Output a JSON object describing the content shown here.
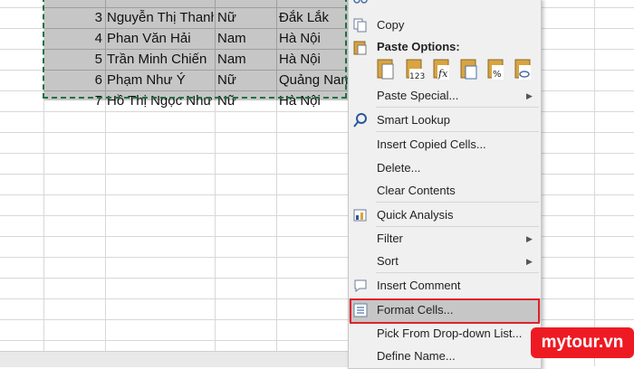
{
  "sheet": {
    "rows": [
      {
        "no": "3",
        "name": "Nguyễn Thị Thanh",
        "gender": "Nữ",
        "place": "Đắk Lắk"
      },
      {
        "no": "4",
        "name": "Phan Văn Hải",
        "gender": "Nam",
        "place": "Hà Nội"
      },
      {
        "no": "5",
        "name": "Trần Minh Chiến",
        "gender": "Nam",
        "place": "Hà Nội"
      },
      {
        "no": "6",
        "name": "Phạm Như Ý",
        "gender": "Nữ",
        "place": "Quảng Nam"
      },
      {
        "no": "7",
        "name": "Hồ Thị Ngọc Như",
        "gender": "Nữ",
        "place": "Hà Nội"
      }
    ]
  },
  "menu": {
    "copy": "Copy",
    "paste_options": "Paste Options:",
    "paste_special": "Paste Special...",
    "smart_lookup": "Smart Lookup",
    "insert_copied_cells": "Insert Copied Cells...",
    "delete": "Delete...",
    "clear_contents": "Clear Contents",
    "quick_analysis": "Quick Analysis",
    "filter": "Filter",
    "sort": "Sort",
    "insert_comment": "Insert Comment",
    "format_cells": "Format Cells...",
    "pick_from_dropdown": "Pick From Drop-down List...",
    "define_name": "Define Name...",
    "highlight_color": "#e0212b"
  },
  "watermark": {
    "text": "mytour.vn",
    "color": "#ee1a23"
  }
}
